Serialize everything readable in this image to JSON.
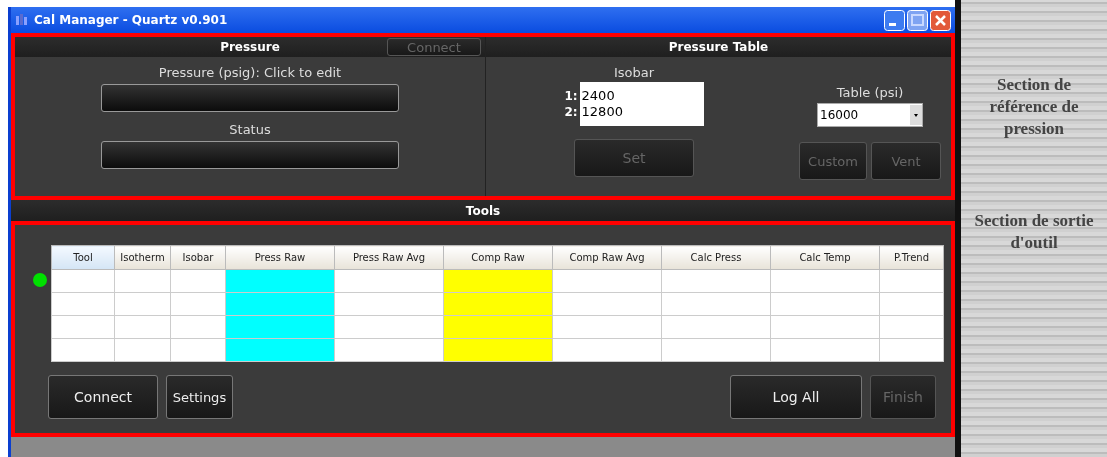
{
  "window": {
    "title": "Cal Manager - Quartz v0.901"
  },
  "pressure": {
    "title": "Pressure",
    "connect_button": {
      "label": "Connect",
      "disabled": true
    },
    "pressure_label": "Pressure (psig): Click to edit",
    "status_label": "Status"
  },
  "pressure_table": {
    "title": "Pressure Table",
    "isobar_label": "Isobar",
    "isobars": [
      {
        "index": "1:",
        "value": "2400"
      },
      {
        "index": "2:",
        "value": "12800"
      }
    ],
    "table_label": "Table (psi)",
    "table_value": "16000",
    "buttons": [
      {
        "label": "Set",
        "disabled": true
      },
      {
        "label": "Custom",
        "disabled": true
      },
      {
        "label": "Vent",
        "disabled": true
      }
    ]
  },
  "tools": {
    "title": "Tools",
    "status_dot": {
      "color": "#00e000"
    },
    "columns": [
      {
        "label": "Tool"
      },
      {
        "label": "Isotherm"
      },
      {
        "label": "Isobar"
      },
      {
        "label": "Press Raw",
        "color": "#00ffff"
      },
      {
        "label": "Press Raw Avg"
      },
      {
        "label": "Comp Raw",
        "color": "#ffff00"
      },
      {
        "label": "Comp Raw Avg"
      },
      {
        "label": "Calc Press"
      },
      {
        "label": "Calc Temp"
      },
      {
        "label": "P.Trend"
      }
    ],
    "buttons": [
      {
        "label": "Connect",
        "disabled": false
      },
      {
        "label": "Settings",
        "disabled": false
      },
      {
        "label": "Log All",
        "disabled": false
      },
      {
        "label": "Finish",
        "disabled": true
      }
    ]
  },
  "annotations": [
    "Section de référence de pression",
    "Section de sortie d'outil"
  ]
}
